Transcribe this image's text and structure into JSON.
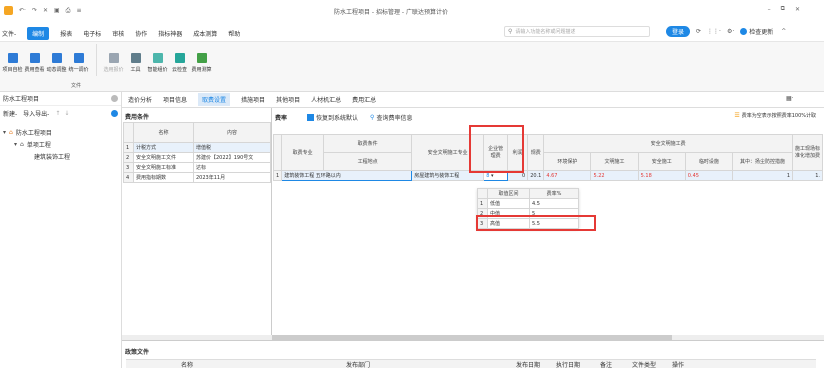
{
  "window": {
    "title": "防水工程项目 - 招标管理 - 广联达预算计价",
    "search_placeholder": "请输入功能名称或问题描述",
    "login_btn": "登录",
    "update_btn": "检查更新",
    "win_controls": [
      "–",
      "⧉",
      "✕"
    ]
  },
  "quick_access": [
    "↶·",
    "↷",
    "✕",
    "▣",
    "⎙",
    "≡"
  ],
  "menu": [
    "文件-",
    "编制",
    "报表",
    "电子标",
    "审核",
    "协作",
    "指标神器",
    "成本测算",
    "帮助"
  ],
  "menu_active": "编制",
  "toolbar": [
    {
      "label": "项目自检",
      "icon": "inspect-icon",
      "color": "#2e7bd6"
    },
    {
      "label": "费用查看",
      "icon": "view-cost-icon",
      "color": "#2e7bd6"
    },
    {
      "label": "动态调整",
      "icon": "dynamic-adjust-icon",
      "color": "#2e7bd6"
    },
    {
      "label": "统一调价",
      "icon": "unify-price-icon",
      "color": "#2e7bd6"
    },
    {
      "label": "选用报价",
      "icon": "select-price-icon",
      "color": "#9aa5b1",
      "disabled": true
    },
    {
      "label": "工具",
      "icon": "tools-icon",
      "color": "#607d8b"
    },
    {
      "label": "智能组价",
      "icon": "smart-price-icon",
      "color": "#4db6ac"
    },
    {
      "label": "云检查",
      "icon": "cloud-check-icon",
      "color": "#26a69a"
    },
    {
      "label": "费用测算",
      "icon": "cost-calc-icon",
      "color": "#43a047"
    }
  ],
  "toolbar_group_label": "文件",
  "sidebar": {
    "header": "防水工程项目",
    "actions": [
      "新建-",
      "导入导出-",
      "↑",
      "↓"
    ],
    "tree": [
      {
        "label": "防水工程项目",
        "icon": "project-icon",
        "level": 0,
        "selected": true
      },
      {
        "label": "单项工程",
        "icon": "house-icon",
        "level": 1
      },
      {
        "label": "建筑装饰工程",
        "level": 2
      }
    ]
  },
  "tabs": [
    "造价分析",
    "项目信息",
    "取费设置",
    "措施项目",
    "其他项目",
    "人材机汇总",
    "费用汇总"
  ],
  "tabs_active": "取费设置",
  "conditions": {
    "title": "费用条件",
    "headers": [
      "名称",
      "内容"
    ],
    "rows": [
      {
        "no": "1",
        "name": "计税方式",
        "value": "增值税"
      },
      {
        "no": "2",
        "name": "安全文明施工文件",
        "value": "苏建价【2022】190号文"
      },
      {
        "no": "3",
        "name": "安全文明施工标准",
        "value": "达标"
      },
      {
        "no": "4",
        "name": "费用指标期数",
        "value": "2023年11月"
      }
    ]
  },
  "rates": {
    "title": "费率",
    "restore_btn": "恢复到系统默认",
    "query_btn": "查询费率信息",
    "right_note": "费率为空表示按照费率100%计取",
    "headers": {
      "c1": "取费专业",
      "c2_top": "取费条件",
      "c2": "工程地点",
      "c3": "安全文明施工专业",
      "c4": "企业管理费",
      "c5": "利润",
      "c6": "规费",
      "c7_group": "安全文明施工费",
      "c7_sub": [
        "环境保护",
        "文明施工",
        "安全施工",
        "临时设施",
        "其中：扬尘防控措施"
      ],
      "c8": "施工现场标准化增加费"
    },
    "row": {
      "no": "1",
      "profession": "建筑装饰工程",
      "location": "五环路以内",
      "safety_profession": "房屋建筑与装饰工程",
      "mgmt_fee": "8",
      "profit": "0",
      "fees": "20.1",
      "sub": [
        "4.67",
        "5.22",
        "5.18",
        "0.45",
        ""
      ],
      "extra": "1",
      "extra2": "1."
    },
    "dropdown": {
      "headers": [
        "取值区间",
        "费率%"
      ],
      "rows": [
        {
          "no": "1",
          "label": "低值",
          "rate": "4.5"
        },
        {
          "no": "2",
          "label": "中值",
          "rate": "5"
        },
        {
          "no": "3",
          "label": "高值",
          "rate": "5.5"
        }
      ]
    }
  },
  "bottom": {
    "title": "政策文件",
    "headers": [
      "名称",
      "发布日期",
      "执行日期",
      "备注",
      "文件类型",
      "操作"
    ],
    "headers_center": "发布部门"
  }
}
